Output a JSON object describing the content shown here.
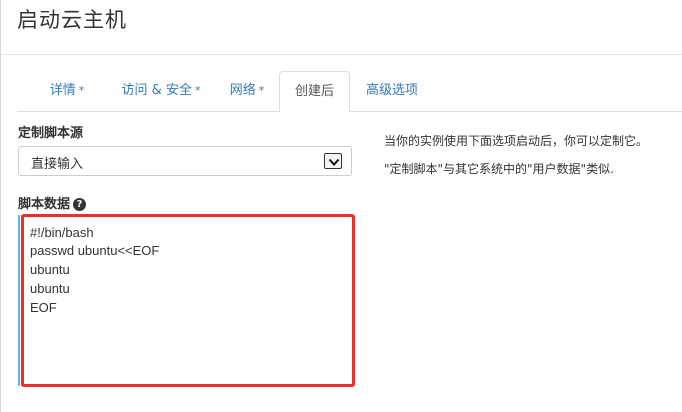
{
  "modal": {
    "title": "启动云主机"
  },
  "tabs": [
    {
      "label": "详情",
      "required": "*"
    },
    {
      "label": "访问 & 安全",
      "required": "*"
    },
    {
      "label": "网络",
      "required": "*"
    },
    {
      "label": "创建后",
      "required": ""
    },
    {
      "label": "高级选项",
      "required": ""
    }
  ],
  "active_tab": "创建后",
  "form": {
    "source_label": "定制脚本源",
    "source_value": "直接输入",
    "script_label": "脚本数据",
    "help_icon_glyph": "?",
    "script_lines": [
      "#!/bin/bash",
      "passwd ubuntu<<EOF",
      "ubuntu",
      "ubuntu",
      "EOF"
    ]
  },
  "help": {
    "line1": "当你的实例使用下面选项启动后，你可以定制它。",
    "line2": "\"定制脚本\"与其它系统中的\"用户数据\"类似."
  },
  "colors": {
    "link": "#337ab7",
    "highlight": "#e8302c",
    "focus": "#66afe9"
  }
}
